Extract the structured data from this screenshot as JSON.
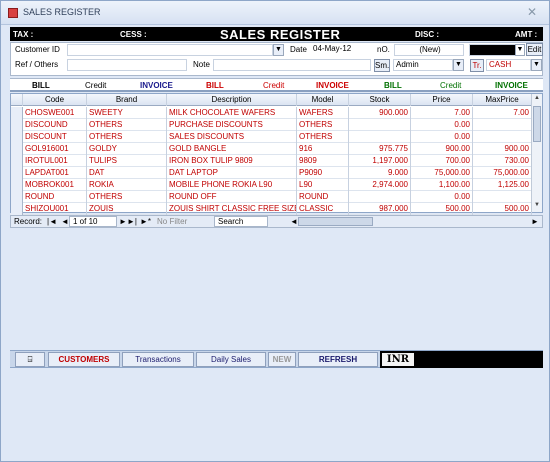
{
  "window": {
    "title": "SALES REGISTER"
  },
  "header": {
    "tax": "TAX :",
    "cess": "CESS :",
    "title": "SALES REGISTER",
    "disc": "DISC :",
    "amt": "AMT :"
  },
  "form": {
    "customer_id_label": "Customer ID",
    "customer_id_value": "",
    "date_label": "Date",
    "date_value": "04-May-12",
    "no_label": "nO.",
    "no_value": "(New)",
    "edit_label": "Edit",
    "ref_label": "Ref / Others",
    "note_label": "Note",
    "sm_label": "Sm.",
    "sm_value": "Admin",
    "tr_label": "Tr.",
    "tr_value": "CASH"
  },
  "mode_tabs": [
    {
      "label": "BILL",
      "color": "#000000",
      "bold": true
    },
    {
      "label": "Credit",
      "color": "#000000",
      "bold": false
    },
    {
      "label": "INVOICE",
      "color": "#1a1a8c",
      "bold": true
    },
    {
      "label": "BILL",
      "color": "#cc0000",
      "bold": true
    },
    {
      "label": "Credit",
      "color": "#cc0000",
      "bold": false
    },
    {
      "label": "INVOICE",
      "color": "#cc0000",
      "bold": true
    },
    {
      "label": "BILL",
      "color": "#007000",
      "bold": true
    },
    {
      "label": "Credit",
      "color": "#007000",
      "bold": false
    },
    {
      "label": "INVOICE",
      "color": "#007000",
      "bold": true
    }
  ],
  "table": {
    "columns": [
      "Code",
      "Brand",
      "Description",
      "Model",
      "Stock",
      "Price",
      "MaxPrice"
    ],
    "rows": [
      [
        "CHOSWE001",
        "SWEETY",
        "MILK CHOCOLATE WAFERS",
        "WAFERS",
        "900.000",
        "7.00",
        "7.00"
      ],
      [
        "DISCOUND",
        "OTHERS",
        "PURCHASE DISCOUNTS",
        "OTHERS",
        "",
        "0.00",
        ""
      ],
      [
        "DISCOUNT",
        "OTHERS",
        "SALES DISCOUNTS",
        "OTHERS",
        "",
        "0.00",
        ""
      ],
      [
        "GOL916001",
        "GOLDY",
        "GOLD BANGLE",
        "916",
        "975.775",
        "900.00",
        "900.00"
      ],
      [
        "IROTUL001",
        "TULIPS",
        "IRON BOX TULIP 9809",
        "9809",
        "1,197.000",
        "700.00",
        "730.00"
      ],
      [
        "LAPDAT001",
        "DAT",
        "DAT LAPTOP",
        "P9090",
        "9.000",
        "75,000.00",
        "75,000.00"
      ],
      [
        "MOBROK001",
        "ROKIA",
        "MOBILE PHONE ROKIA L90",
        "L90",
        "2,974.000",
        "1,100.00",
        "1,125.00"
      ],
      [
        "ROUND",
        "OTHERS",
        "ROUND OFF",
        "ROUND",
        "",
        "0.00",
        ""
      ],
      [
        "SHIZOU001",
        "ZOUIS",
        "ZOUIS SHIRT CLASSIC FREE SIZE",
        "CLASSIC",
        "987.000",
        "500.00",
        "500.00"
      ]
    ]
  },
  "navigator": {
    "record_label": "Record:",
    "position": "1 of 10",
    "filter_label": "No Filter",
    "search_label": "Search"
  },
  "bottom": {
    "customers": "CUSTOMERS",
    "transactions": "Transactions",
    "daily_sales": "Daily Sales",
    "new": "NEW",
    "refresh": "REFRESH",
    "currency": "INR"
  }
}
